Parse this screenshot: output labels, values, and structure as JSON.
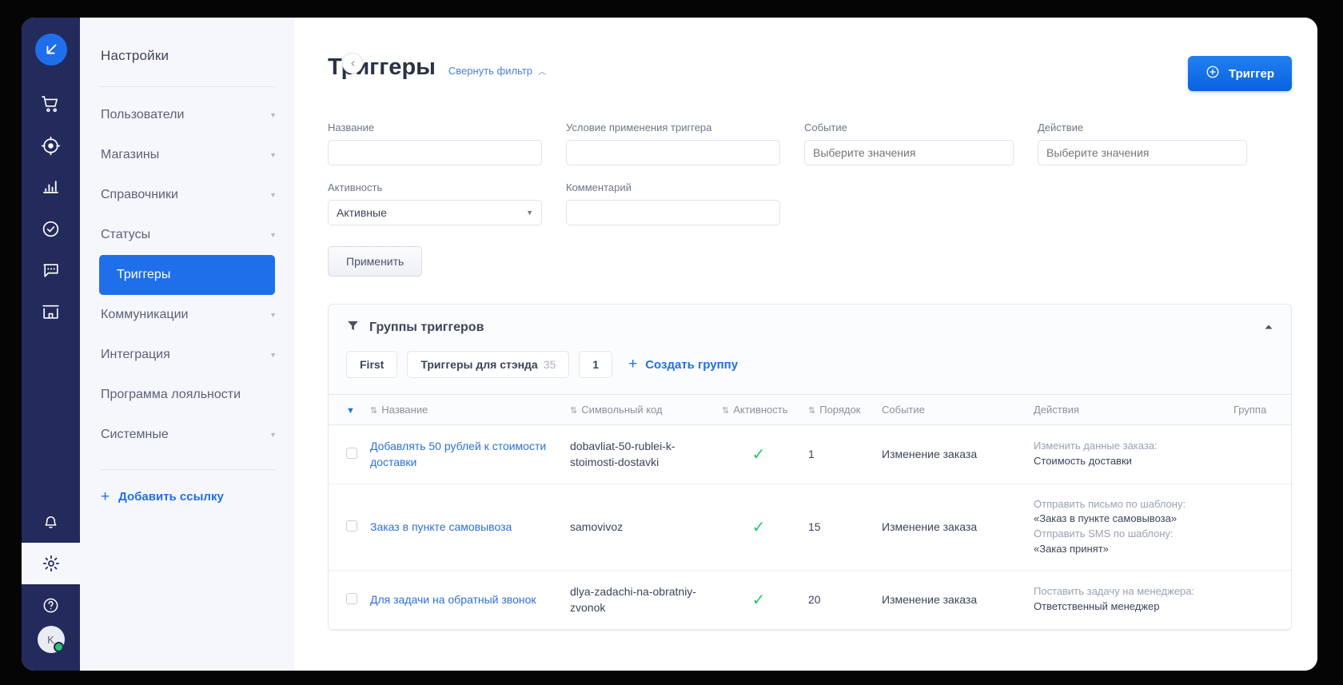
{
  "rail": {
    "logo_icon": "app-logo-icon",
    "items": [
      {
        "name": "cart-icon"
      },
      {
        "name": "target-icon"
      },
      {
        "name": "analytics-icon"
      },
      {
        "name": "check-circle-icon"
      },
      {
        "name": "chat-icon"
      },
      {
        "name": "store-icon"
      }
    ],
    "bottom_items": [
      {
        "name": "bell-icon"
      },
      {
        "name": "gear-icon"
      },
      {
        "name": "help-icon"
      }
    ],
    "avatar_initial": "K"
  },
  "subnav": {
    "title": "Настройки",
    "items": [
      {
        "label": "Пользователи",
        "expandable": true,
        "active": false
      },
      {
        "label": "Магазины",
        "expandable": true,
        "active": false
      },
      {
        "label": "Справочники",
        "expandable": true,
        "active": false
      },
      {
        "label": "Статусы",
        "expandable": true,
        "active": false
      },
      {
        "label": "Триггеры",
        "expandable": false,
        "active": true
      },
      {
        "label": "Коммуникации",
        "expandable": true,
        "active": false
      },
      {
        "label": "Интеграция",
        "expandable": true,
        "active": false
      },
      {
        "label": "Программа лояльности",
        "expandable": false,
        "active": false
      },
      {
        "label": "Системные",
        "expandable": true,
        "active": false
      }
    ],
    "add_link": "Добавить ссылку",
    "collapse_icon": "chevron-left-icon"
  },
  "header": {
    "title": "Триггеры",
    "filter_toggle": "Свернуть фильтр",
    "filter_toggle_icon": "chevron-up-icon",
    "add_button": "Триггер",
    "add_button_icon": "plus-circle-icon"
  },
  "filters": {
    "name": {
      "label": "Название",
      "value": "",
      "placeholder": ""
    },
    "condition": {
      "label": "Условие применения триггера",
      "value": "",
      "placeholder": ""
    },
    "event": {
      "label": "Событие",
      "value": "",
      "placeholder": "Выберите значения"
    },
    "action": {
      "label": "Действие",
      "value": "",
      "placeholder": "Выберите значения"
    },
    "activity": {
      "label": "Активность",
      "value": "Активные",
      "options": [
        "Активные"
      ]
    },
    "comment": {
      "label": "Комментарий",
      "value": "",
      "placeholder": ""
    },
    "apply_button": "Применить"
  },
  "groups_panel": {
    "title": "Группы триггеров",
    "filter_icon": "funnel-icon",
    "collapse_icon": "chevron-up-icon",
    "chips": [
      {
        "label": "First",
        "count": ""
      },
      {
        "label": "Триггеры для стэнда",
        "count": "35"
      },
      {
        "label": "1",
        "count": ""
      }
    ],
    "create_group": "Создать группу",
    "create_group_icon": "plus-icon"
  },
  "table": {
    "columns": [
      {
        "label": "",
        "sortable": false,
        "key": "select"
      },
      {
        "label": "Название",
        "sortable": true,
        "key": "name"
      },
      {
        "label": "Символьный код",
        "sortable": true,
        "key": "code"
      },
      {
        "label": "Активность",
        "sortable": true,
        "key": "active"
      },
      {
        "label": "Порядок",
        "sortable": true,
        "key": "order"
      },
      {
        "label": "Событие",
        "sortable": false,
        "key": "event"
      },
      {
        "label": "Действия",
        "sortable": false,
        "key": "actions"
      },
      {
        "label": "Группа",
        "sortable": false,
        "key": "group"
      }
    ],
    "rows": [
      {
        "name": "Добавлять 50 рублей к стоимости доставки",
        "code": "dobavliat-50-rublei-k-stoimosti-dostavki",
        "active": true,
        "order": "1",
        "event": "Изменение заказа",
        "actions": [
          {
            "title": "Изменить данные заказа:",
            "value": "Стоимость доставки"
          }
        ],
        "group": ""
      },
      {
        "name": "Заказ в пункте самовывоза",
        "code": "samovivoz",
        "active": true,
        "order": "15",
        "event": "Изменение заказа",
        "actions": [
          {
            "title": "Отправить письмо по шаблону:",
            "value": "«Заказ в пункте самовывоза»"
          },
          {
            "title": "Отправить SMS по шаблону:",
            "value": "«Заказ принят»"
          }
        ],
        "group": ""
      },
      {
        "name": "Для задачи на обратный звонок",
        "code": "dlya-zadachi-na-obratniy-zvonok",
        "active": true,
        "order": "20",
        "event": "Изменение заказа",
        "actions": [
          {
            "title": "Поставить задачу на менеджера:",
            "value": "Ответственный менеджер"
          }
        ],
        "group": ""
      }
    ],
    "check_icon": "check-icon",
    "sort_icon": "sort-icon",
    "header_caret_icon": "caret-down-icon"
  },
  "colors": {
    "accent": "#1f6feb",
    "rail_bg": "#232a5c",
    "subnav_bg": "#f6f7fb",
    "success": "#2bc36b",
    "link": "#2e6fd6"
  }
}
